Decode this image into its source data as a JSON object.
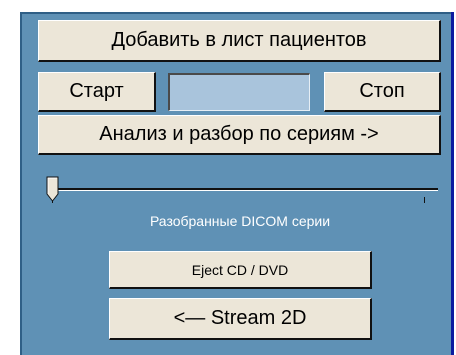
{
  "buttons": {
    "add_to_patients": "Добавить в лист пациентов",
    "start": "Старт",
    "stop": "Стоп",
    "analyze_series": "Анализ и разбор по сериям ->",
    "eject": "Eject CD / DVD",
    "stream_2d": "<— Stream 2D"
  },
  "input": {
    "value": ""
  },
  "slider": {
    "value": 0
  },
  "caption": "Разобранные DICOM серии",
  "colors": {
    "panel_bg": "#5f91b5",
    "button_bg": "#ece6d8",
    "field_bg": "#a9c4dc",
    "caption": "#ffffff"
  }
}
